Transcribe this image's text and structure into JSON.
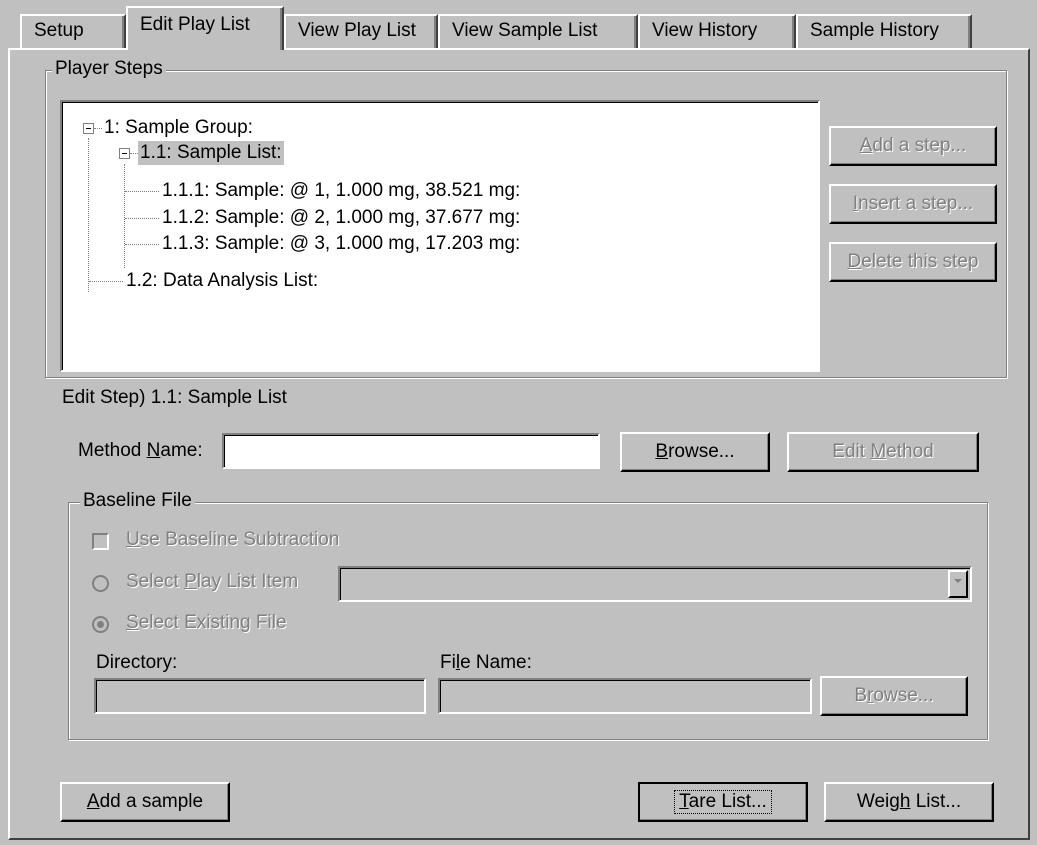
{
  "tabs": [
    {
      "label": "Setup"
    },
    {
      "label": "Edit Play List"
    },
    {
      "label": "View Play List"
    },
    {
      "label": "View Sample List"
    },
    {
      "label": "View History"
    },
    {
      "label": "Sample History"
    }
  ],
  "player_steps": {
    "group_label": "Player Steps",
    "tree": [
      {
        "text": "1: Sample Group:"
      },
      {
        "text": "1.1: Sample List:"
      },
      {
        "text": "1.1.1: Sample:  @ 1, 1.000 mg, 38.521 mg:"
      },
      {
        "text": "1.1.2: Sample:  @ 2, 1.000 mg, 37.677 mg:"
      },
      {
        "text": "1.1.3: Sample:  @ 3, 1.000 mg, 17.203 mg:"
      },
      {
        "text": "1.2: Data Analysis List:"
      }
    ],
    "buttons": {
      "add_step": {
        "pre": "",
        "key": "A",
        "post": "dd a step..."
      },
      "insert_step": {
        "pre": "",
        "key": "I",
        "post": "nsert a step..."
      },
      "delete_step": {
        "pre": "",
        "key": "D",
        "post": "elete this step"
      }
    }
  },
  "edit_step": {
    "title": "Edit Step)  1.1: Sample List",
    "method_name": {
      "pre": "Method ",
      "key": "N",
      "post": "ame:",
      "value": ""
    },
    "browse": {
      "pre": "",
      "key": "B",
      "post": "rowse..."
    },
    "edit_method": {
      "pre": "Edit ",
      "key": "M",
      "post": "ethod"
    }
  },
  "baseline": {
    "group_label": "Baseline File",
    "use_subtraction": {
      "pre": "",
      "key": "U",
      "post": "se Baseline Subtraction",
      "checked": false
    },
    "select_play_list": {
      "pre": "Select ",
      "key": "P",
      "post": "lay List Item",
      "selected": false,
      "value": ""
    },
    "select_existing": {
      "pre": "",
      "key": "S",
      "post": "elect Existing File",
      "selected": true
    },
    "directory_label": "Directory:",
    "directory_value": "",
    "file_name_label": {
      "pre": "Fi",
      "key": "l",
      "post": "e Name:"
    },
    "file_name_value": "",
    "browse": {
      "pre": "B",
      "key": "r",
      "post": "owse..."
    }
  },
  "bottom_buttons": {
    "add_sample": {
      "pre": "",
      "key": "A",
      "post": "dd a sample"
    },
    "tare_list": {
      "pre": "",
      "key": "T",
      "post": "are List..."
    },
    "weigh_list": {
      "pre": "Weig",
      "key": "h",
      "post": " List..."
    }
  }
}
